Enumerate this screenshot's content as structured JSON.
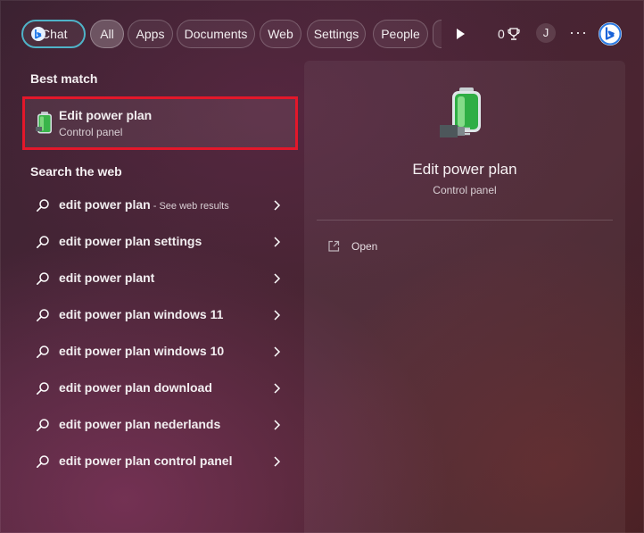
{
  "filters": {
    "chat": "Chat",
    "all": "All",
    "apps": "Apps",
    "documents": "Documents",
    "web": "Web",
    "settings": "Settings",
    "people": "People"
  },
  "header": {
    "points": "0",
    "avatar_initial": "J",
    "more": "···"
  },
  "best_match": {
    "heading": "Best match",
    "title": "Edit power plan",
    "subtitle": "Control panel"
  },
  "search_web": {
    "heading": "Search the web",
    "items": [
      {
        "text": "edit power plan",
        "sub": " - See web results"
      },
      {
        "text": "edit power plan settings",
        "sub": ""
      },
      {
        "text": "edit power plant",
        "sub": ""
      },
      {
        "text": "edit power plan windows 11",
        "sub": ""
      },
      {
        "text": "edit power plan windows 10",
        "sub": ""
      },
      {
        "text": "edit power plan download",
        "sub": ""
      },
      {
        "text": "edit power plan nederlands",
        "sub": ""
      },
      {
        "text": "edit power plan control panel",
        "sub": ""
      }
    ]
  },
  "preview": {
    "title": "Edit power plan",
    "subtitle": "Control panel",
    "actions": [
      {
        "label": "Open",
        "icon": "open-icon"
      }
    ]
  },
  "colors": {
    "highlight_border": "#e3172a",
    "chat_border": "#4fb3c8"
  }
}
